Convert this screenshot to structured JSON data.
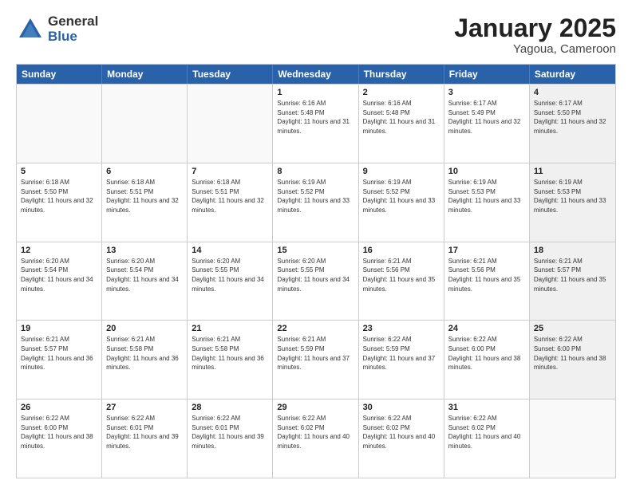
{
  "header": {
    "logo_general": "General",
    "logo_blue": "Blue",
    "month_title": "January 2025",
    "location": "Yagoua, Cameroon"
  },
  "weekdays": [
    "Sunday",
    "Monday",
    "Tuesday",
    "Wednesday",
    "Thursday",
    "Friday",
    "Saturday"
  ],
  "rows": [
    [
      {
        "day": "",
        "info": "",
        "empty": true
      },
      {
        "day": "",
        "info": "",
        "empty": true
      },
      {
        "day": "",
        "info": "",
        "empty": true
      },
      {
        "day": "1",
        "info": "Sunrise: 6:16 AM\nSunset: 5:48 PM\nDaylight: 11 hours and 31 minutes."
      },
      {
        "day": "2",
        "info": "Sunrise: 6:16 AM\nSunset: 5:48 PM\nDaylight: 11 hours and 31 minutes."
      },
      {
        "day": "3",
        "info": "Sunrise: 6:17 AM\nSunset: 5:49 PM\nDaylight: 11 hours and 32 minutes."
      },
      {
        "day": "4",
        "info": "Sunrise: 6:17 AM\nSunset: 5:50 PM\nDaylight: 11 hours and 32 minutes.",
        "shaded": true
      }
    ],
    [
      {
        "day": "5",
        "info": "Sunrise: 6:18 AM\nSunset: 5:50 PM\nDaylight: 11 hours and 32 minutes."
      },
      {
        "day": "6",
        "info": "Sunrise: 6:18 AM\nSunset: 5:51 PM\nDaylight: 11 hours and 32 minutes."
      },
      {
        "day": "7",
        "info": "Sunrise: 6:18 AM\nSunset: 5:51 PM\nDaylight: 11 hours and 32 minutes."
      },
      {
        "day": "8",
        "info": "Sunrise: 6:19 AM\nSunset: 5:52 PM\nDaylight: 11 hours and 33 minutes."
      },
      {
        "day": "9",
        "info": "Sunrise: 6:19 AM\nSunset: 5:52 PM\nDaylight: 11 hours and 33 minutes."
      },
      {
        "day": "10",
        "info": "Sunrise: 6:19 AM\nSunset: 5:53 PM\nDaylight: 11 hours and 33 minutes."
      },
      {
        "day": "11",
        "info": "Sunrise: 6:19 AM\nSunset: 5:53 PM\nDaylight: 11 hours and 33 minutes.",
        "shaded": true
      }
    ],
    [
      {
        "day": "12",
        "info": "Sunrise: 6:20 AM\nSunset: 5:54 PM\nDaylight: 11 hours and 34 minutes."
      },
      {
        "day": "13",
        "info": "Sunrise: 6:20 AM\nSunset: 5:54 PM\nDaylight: 11 hours and 34 minutes."
      },
      {
        "day": "14",
        "info": "Sunrise: 6:20 AM\nSunset: 5:55 PM\nDaylight: 11 hours and 34 minutes."
      },
      {
        "day": "15",
        "info": "Sunrise: 6:20 AM\nSunset: 5:55 PM\nDaylight: 11 hours and 34 minutes."
      },
      {
        "day": "16",
        "info": "Sunrise: 6:21 AM\nSunset: 5:56 PM\nDaylight: 11 hours and 35 minutes."
      },
      {
        "day": "17",
        "info": "Sunrise: 6:21 AM\nSunset: 5:56 PM\nDaylight: 11 hours and 35 minutes."
      },
      {
        "day": "18",
        "info": "Sunrise: 6:21 AM\nSunset: 5:57 PM\nDaylight: 11 hours and 35 minutes.",
        "shaded": true
      }
    ],
    [
      {
        "day": "19",
        "info": "Sunrise: 6:21 AM\nSunset: 5:57 PM\nDaylight: 11 hours and 36 minutes."
      },
      {
        "day": "20",
        "info": "Sunrise: 6:21 AM\nSunset: 5:58 PM\nDaylight: 11 hours and 36 minutes."
      },
      {
        "day": "21",
        "info": "Sunrise: 6:21 AM\nSunset: 5:58 PM\nDaylight: 11 hours and 36 minutes."
      },
      {
        "day": "22",
        "info": "Sunrise: 6:21 AM\nSunset: 5:59 PM\nDaylight: 11 hours and 37 minutes."
      },
      {
        "day": "23",
        "info": "Sunrise: 6:22 AM\nSunset: 5:59 PM\nDaylight: 11 hours and 37 minutes."
      },
      {
        "day": "24",
        "info": "Sunrise: 6:22 AM\nSunset: 6:00 PM\nDaylight: 11 hours and 38 minutes."
      },
      {
        "day": "25",
        "info": "Sunrise: 6:22 AM\nSunset: 6:00 PM\nDaylight: 11 hours and 38 minutes.",
        "shaded": true
      }
    ],
    [
      {
        "day": "26",
        "info": "Sunrise: 6:22 AM\nSunset: 6:00 PM\nDaylight: 11 hours and 38 minutes."
      },
      {
        "day": "27",
        "info": "Sunrise: 6:22 AM\nSunset: 6:01 PM\nDaylight: 11 hours and 39 minutes."
      },
      {
        "day": "28",
        "info": "Sunrise: 6:22 AM\nSunset: 6:01 PM\nDaylight: 11 hours and 39 minutes."
      },
      {
        "day": "29",
        "info": "Sunrise: 6:22 AM\nSunset: 6:02 PM\nDaylight: 11 hours and 40 minutes."
      },
      {
        "day": "30",
        "info": "Sunrise: 6:22 AM\nSunset: 6:02 PM\nDaylight: 11 hours and 40 minutes."
      },
      {
        "day": "31",
        "info": "Sunrise: 6:22 AM\nSunset: 6:02 PM\nDaylight: 11 hours and 40 minutes."
      },
      {
        "day": "",
        "info": "",
        "empty": true
      }
    ]
  ]
}
